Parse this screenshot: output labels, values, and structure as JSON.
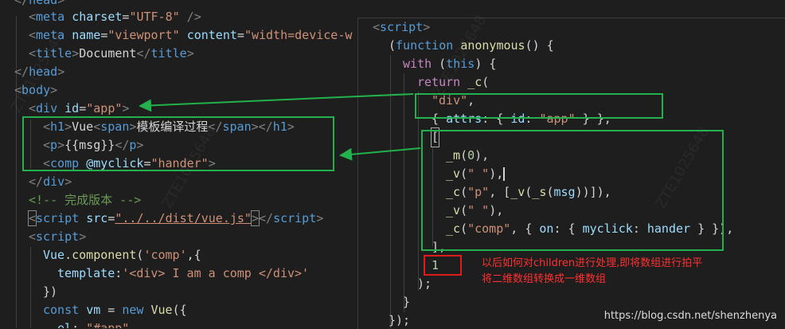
{
  "left_code": {
    "l0": [
      "<",
      "/",
      "head",
      ">"
    ],
    "l1": {
      "tag": "meta",
      "attr1": "charset",
      "val1": "\"UTF-8\"",
      "close": " />"
    },
    "l2": {
      "tag": "meta",
      "attr1": "name",
      "val1": "\"viewport\"",
      "attr2": "content",
      "val2": "\"width=device-w"
    },
    "l3": {
      "open": "title",
      "text": "Document",
      "close": "title"
    },
    "l4": "head",
    "l5": "body",
    "l6": {
      "tag": "div",
      "attr": "id",
      "val": "\"app\""
    },
    "l7": {
      "h1": "h1",
      "text": "Vue",
      "span": "span",
      "cn": "模板编译过程"
    },
    "l8": {
      "tag": "p",
      "text": "{{msg}}"
    },
    "l9": {
      "tag": "comp",
      "attr": "@myclick",
      "val": "\"hander\""
    },
    "l10": "div",
    "l11": "<!-- 完成版本 -->",
    "l12": {
      "tag": "script",
      "attr": "src",
      "val": "\"../../dist/vue.js\""
    },
    "l13": "script",
    "l14": {
      "obj": "Vue",
      "fn": "component",
      "arg": "'comp'"
    },
    "l15": {
      "key": "template",
      "val": "'<div> I am a comp </div>'"
    },
    "l16": "})",
    "l17": {
      "kw": "const",
      "var": "vm",
      "new": "new",
      "cls": "Vue"
    },
    "l18": {
      "key": "el",
      "val": "\"#app\""
    }
  },
  "right_code": {
    "r0": "script",
    "r1": {
      "kw": "function",
      "fn": "anonymous"
    },
    "r2": {
      "kw": "with",
      "this": "this"
    },
    "r3": {
      "kw": "return",
      "fn": "_c"
    },
    "r4": "\"div\"",
    "r5": {
      "key": "attrs",
      "k2": "id",
      "val": "\"app\""
    },
    "r6": "[",
    "r7": {
      "fn": "_m",
      "num": "0"
    },
    "r8": {
      "fn": "_v",
      "str": "\" \""
    },
    "r9": {
      "fn": "_c",
      "tag": "\"p\"",
      "v": "_v",
      "s": "_s",
      "msg": "msg"
    },
    "r10": {
      "fn": "_v",
      "str": "\" \""
    },
    "r11": {
      "fn": "_c",
      "tag": "\"comp\"",
      "on": "on",
      "ev": "myclick",
      "h": "hander"
    },
    "r12": "],",
    "r13": "1",
    "r14": ");",
    "r15": "}",
    "r16": "});"
  },
  "annotation": {
    "line1": "以后如何对children进行处理,即将数组进行拍平",
    "line2": "将二维数组转换成一维数组"
  },
  "footer_url": "https://blog.csdn.net/shenzhenya",
  "watermark": "ZTE1025648",
  "colors": {
    "highlight_box": "#22b14c",
    "note": "#ff3030",
    "background": "#1e1e1e"
  }
}
